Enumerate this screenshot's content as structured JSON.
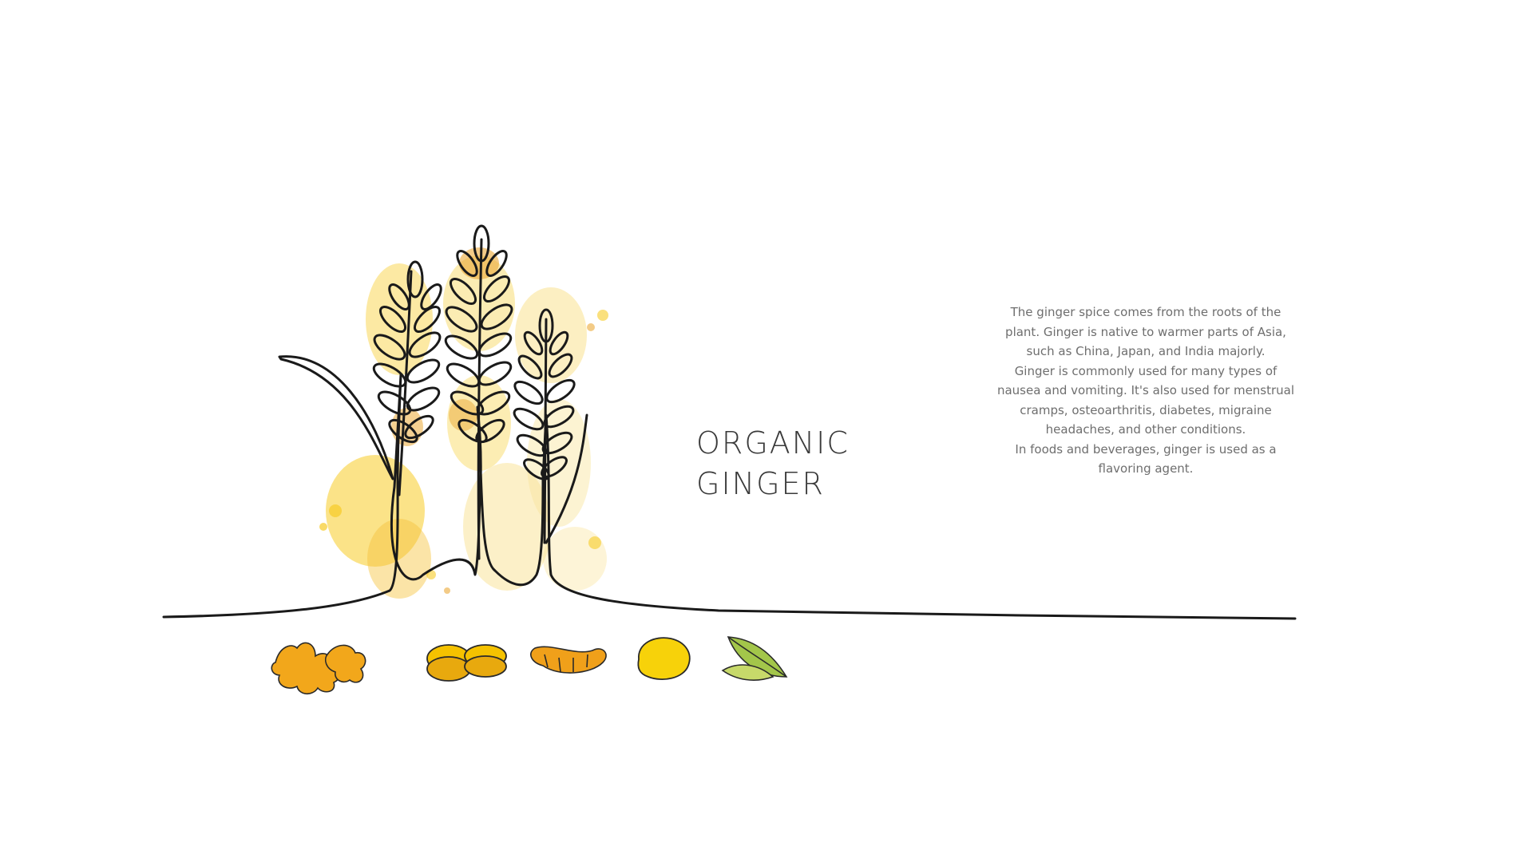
{
  "slide": {
    "title_line1": "ORGANIC",
    "title_line2": "GINGER",
    "description_lines": [
      "The ginger spice comes from the roots of the",
      "plant. Ginger is native to warmer parts of Asia,",
      "such as China, Japan, and India majorly.",
      "Ginger is commonly used for many types of",
      "nausea and vomiting. It's also used for menstrual",
      "cramps, osteoarthritis, diabetes, migraine",
      "headaches, and other conditions.",
      "In foods and beverages, ginger is used as a",
      "flavoring agent."
    ]
  },
  "icons": [
    "wheat-stalks-illustration",
    "ginger-root-icon",
    "ginger-slices-icon",
    "turmeric-root-icon",
    "lemon-icon",
    "leaf-icon"
  ],
  "colors": {
    "accent_yellow": "#f5c200",
    "accent_orange": "#e89a14",
    "line": "#1a1a1a",
    "text_title": "#3a3a3a",
    "text_body": "#6e6e6e"
  }
}
